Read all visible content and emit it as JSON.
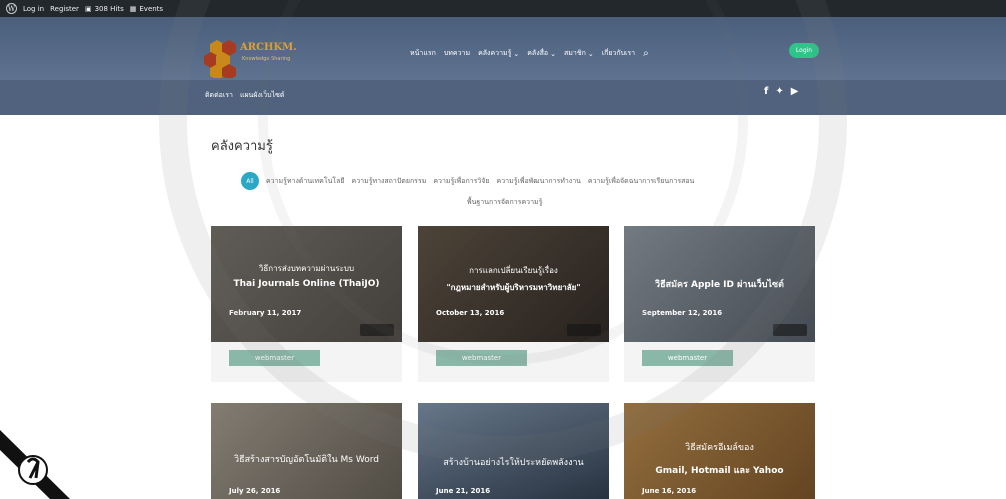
{
  "admin_bar": {
    "login": "Log in",
    "register": "Register",
    "hits": "308 Hits",
    "events": "Events"
  },
  "logo": {
    "name": "ARCHKM.",
    "tagline": "Knowledge Sharing"
  },
  "nav": {
    "items": [
      {
        "label": "หน้าแรก",
        "has_dropdown": false
      },
      {
        "label": "บทความ",
        "has_dropdown": false
      },
      {
        "label": "คลังความรู้",
        "has_dropdown": true
      },
      {
        "label": "คลังสื่อ",
        "has_dropdown": true
      },
      {
        "label": "สมาชิก",
        "has_dropdown": true
      },
      {
        "label": "เกี่ยวกับเรา",
        "has_dropdown": false
      }
    ],
    "login_label": "Login"
  },
  "subnav": {
    "links": [
      "ติดต่อเรา",
      "แผนผังเว็บไซต์"
    ],
    "social": [
      "facebook-icon",
      "twitter-icon",
      "youtube-icon"
    ]
  },
  "page": {
    "title": "คลังความรู้"
  },
  "filters": {
    "all_label": "All",
    "items": [
      "ความรู้ทางด้านเทคโนโลยี",
      "ความรู้ทางสถาปัตยกรรม",
      "ความรู้เพื่อการวิจัย",
      "ความรู้เพื่อพัฒนาการทำงาน",
      "ความรู้เพื่อจัดฉนาการเรียนการสอน"
    ],
    "second_row": "พื้นฐานการจัดการความรู้"
  },
  "cards": [
    {
      "line1": "วิธีการส่งบทความผ่านระบบ",
      "line2": "Thai Journals Online (ThaiJO)",
      "date": "February 11, 2017",
      "author": "webmaster",
      "color": "#6e6a63"
    },
    {
      "line1": "การแลกเปลี่ยนเรียนรู้เรื่อง",
      "line2": "\"กฎหมายสำหรับผู้บริหารมหาวิทยาลัย\"",
      "date": "October 13, 2016",
      "author": "webmaster",
      "color": "#4d4238"
    },
    {
      "line1": "",
      "line2": "วิธีสมัคร Apple ID ผ่านเว็บไซต์",
      "date": "September 12, 2016",
      "author": "webmaster",
      "color": "#7a8592"
    }
  ],
  "cards_row2": [
    {
      "line1": "",
      "line2": "วิธีสร้างสารบัญอัตโนมัติใน Ms Word",
      "date": "July 26, 2016",
      "color": "#7f776a"
    },
    {
      "line1": "",
      "line2": "สร้างบ้านอย่างไรให้ประหยัดพลังงาน",
      "date": "June 21, 2016",
      "color": "#5a6f85"
    },
    {
      "line1": "วิธีสมัครอีเมล์ของ",
      "line2": "Gmail, Hotmail และ Yahoo",
      "date": "June 16, 2016",
      "color": "#b07a3c"
    }
  ]
}
